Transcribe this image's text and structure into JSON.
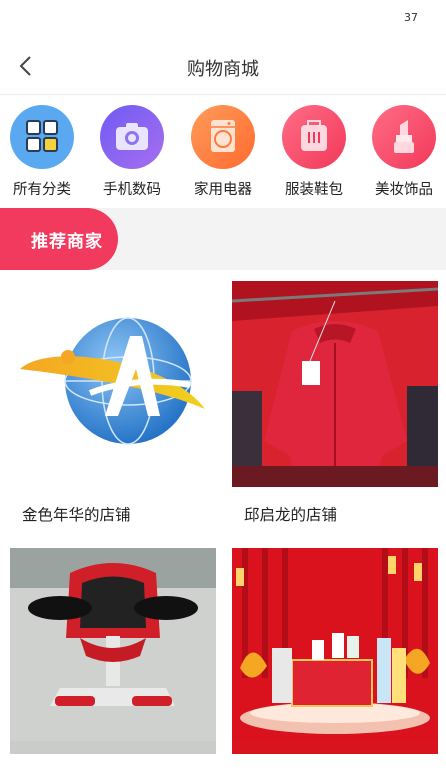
{
  "status": {
    "battery": "37"
  },
  "header": {
    "title": "购物商城"
  },
  "categories": [
    {
      "label": "所有分类",
      "icon": "grid-icon",
      "color": "#5aa9f0"
    },
    {
      "label": "手机数码",
      "icon": "camera-icon",
      "color": "#8a5cf0"
    },
    {
      "label": "家用电器",
      "icon": "washing-machine-icon",
      "color": "#ff7a3d"
    },
    {
      "label": "服装鞋包",
      "icon": "bag-icon",
      "color": "#ff4d6d"
    },
    {
      "label": "美妆饰品",
      "icon": "lipstick-icon",
      "color": "#ff4d6d"
    }
  ],
  "section": {
    "title": "推荐商家"
  },
  "shops": [
    {
      "name": "金色年华的店铺"
    },
    {
      "name": "邱启龙的店铺"
    },
    {
      "name": ""
    },
    {
      "name": ""
    }
  ]
}
